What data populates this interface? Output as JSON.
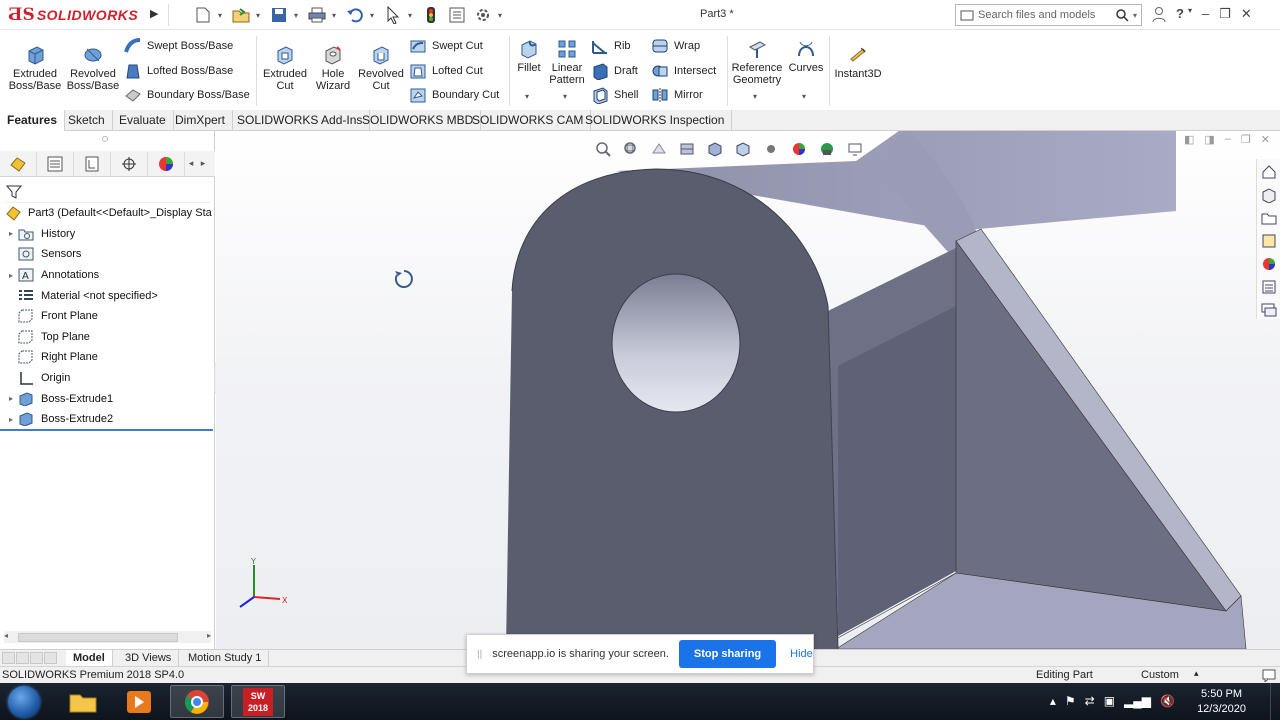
{
  "titlebar": {
    "app_name": "SOLIDWORKS",
    "doc_title": "Part3 *",
    "search_placeholder": "Search files and models"
  },
  "ribbon": {
    "extruded_boss": "Extruded Boss/Base",
    "revolved_boss": "Revolved Boss/Base",
    "swept_boss": "Swept Boss/Base",
    "lofted_boss": "Lofted Boss/Base",
    "boundary_boss": "Boundary Boss/Base",
    "extruded_cut": "Extruded Cut",
    "hole_wizard": "Hole Wizard",
    "revolved_cut": "Revolved Cut",
    "swept_cut": "Swept Cut",
    "lofted_cut": "Lofted Cut",
    "boundary_cut": "Boundary Cut",
    "fillet": "Fillet",
    "linear_pattern": "Linear Pattern",
    "rib": "Rib",
    "draft": "Draft",
    "shell": "Shell",
    "wrap": "Wrap",
    "intersect": "Intersect",
    "mirror": "Mirror",
    "reference_geometry": "Reference Geometry",
    "curves": "Curves",
    "instant3d": "Instant3D"
  },
  "command_tabs": [
    "Features",
    "Sketch",
    "Evaluate",
    "DimXpert",
    "SOLIDWORKS Add-Ins",
    "SOLIDWORKS MBD",
    "SOLIDWORKS CAM",
    "SOLIDWORKS Inspection"
  ],
  "feature_tree": {
    "root": "Part3  (Default<<Default>_Display Sta",
    "items": [
      {
        "label": "History",
        "expandable": true,
        "icon": "history-folder-icon"
      },
      {
        "label": "Sensors",
        "expandable": false,
        "icon": "sensors-icon"
      },
      {
        "label": "Annotations",
        "expandable": true,
        "icon": "annotations-icon"
      },
      {
        "label": "Material <not specified>",
        "expandable": false,
        "icon": "material-icon"
      },
      {
        "label": "Front Plane",
        "expandable": false,
        "icon": "plane-icon"
      },
      {
        "label": "Top Plane",
        "expandable": false,
        "icon": "plane-icon"
      },
      {
        "label": "Right Plane",
        "expandable": false,
        "icon": "plane-icon"
      },
      {
        "label": "Origin",
        "expandable": false,
        "icon": "origin-icon"
      },
      {
        "label": "Boss-Extrude1",
        "expandable": true,
        "icon": "boss-extrude-icon"
      },
      {
        "label": "Boss-Extrude2",
        "expandable": true,
        "icon": "boss-extrude-icon"
      }
    ]
  },
  "model_tabs": [
    "Model",
    "3D Views",
    "Motion Study 1"
  ],
  "status": {
    "product": "SOLIDWORKS Premium 2018 SP4.0",
    "mode": "Editing Part",
    "units": "Custom"
  },
  "share_popup": {
    "message": "screenapp.io is sharing your screen.",
    "stop_label": "Stop sharing",
    "hide_label": "Hide"
  },
  "taskbar": {
    "time": "5:50 PM",
    "date": "12/3/2020",
    "sw_badge": "2018"
  },
  "colors": {
    "brand_red": "#d0202a",
    "share_blue": "#1a73e8",
    "part_face_dark": "#5a5d6e",
    "part_face_light": "#9b9db6"
  }
}
